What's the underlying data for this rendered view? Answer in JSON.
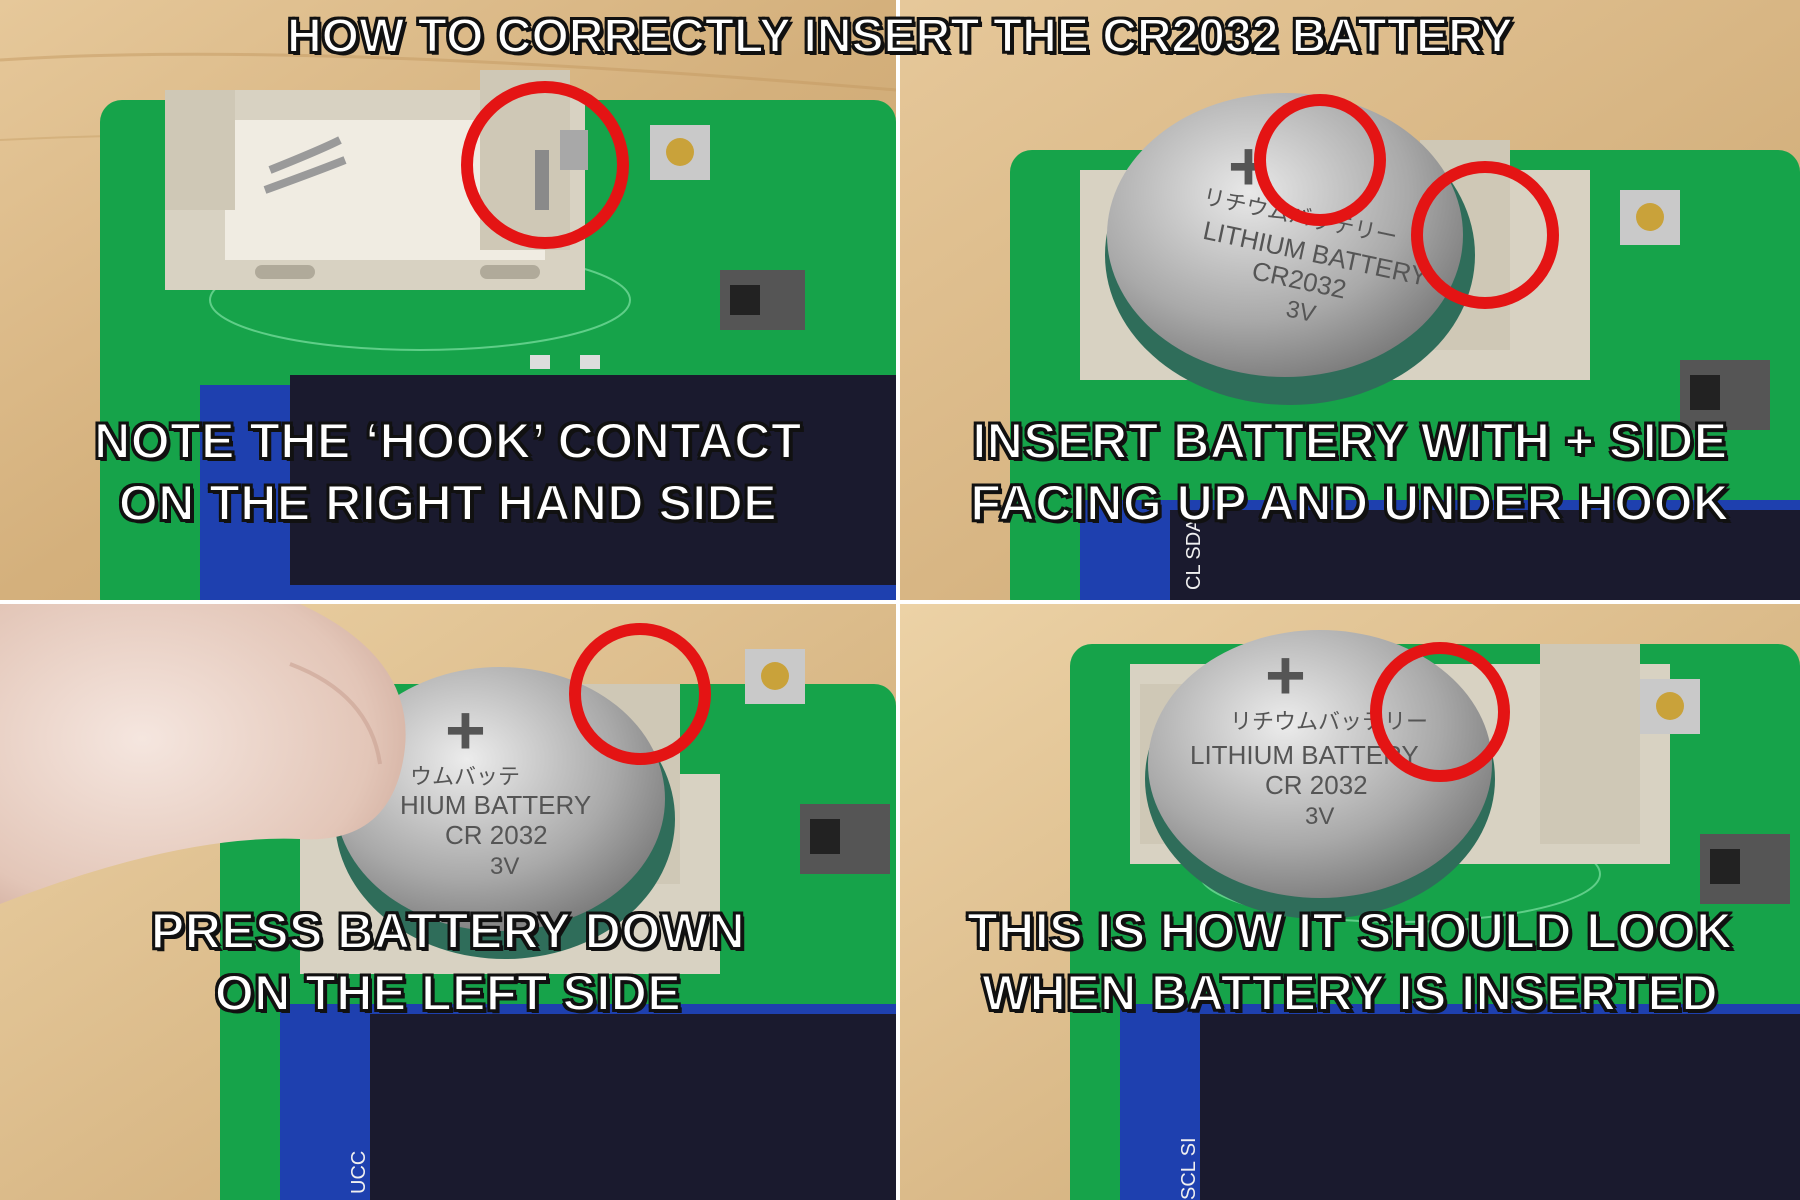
{
  "title": "HOW TO CORRECTLY INSERT THE CR2032 BATTERY",
  "panels": [
    {
      "caption": [
        "NOTE THE ‘HOOK’ CONTACT",
        "ON THE RIGHT HAND SIDE"
      ]
    },
    {
      "caption": [
        "INSERT BATTERY WITH + SIDE",
        "FACING UP AND UNDER HOOK"
      ],
      "battery": {
        "plus": "+",
        "jp": "リチウムバッテリー",
        "brand": "LITHIUM BATTERY",
        "model": "CR2032",
        "volt": "3V"
      },
      "board_label": "CL SDA"
    },
    {
      "caption": [
        "PRESS BATTERY DOWN",
        "ON THE LEFT SIDE"
      ],
      "battery": {
        "plus": "+",
        "jp": "ウムバッテ",
        "brand": "HIUM BATTERY",
        "model": "CR 2032",
        "volt": "3V"
      },
      "board_label": "UCC"
    },
    {
      "caption": [
        "THIS IS HOW IT SHOULD LOOK",
        "WHEN BATTERY IS INSERTED"
      ],
      "battery": {
        "plus": "+",
        "jp": "リチウムバッテリー",
        "brand": "LITHIUM BATTERY",
        "model": "CR 2032",
        "volt": "3V"
      },
      "board_label": "SCL SI"
    }
  ],
  "colors": {
    "pcb": "#16a34a",
    "pcb_dark": "#0f7a36",
    "wood": "#d9b98a",
    "holder": "#d8d2c2",
    "circle": "#e41414",
    "battery": "#b8b8b8",
    "oled": "#1a1a2e"
  }
}
